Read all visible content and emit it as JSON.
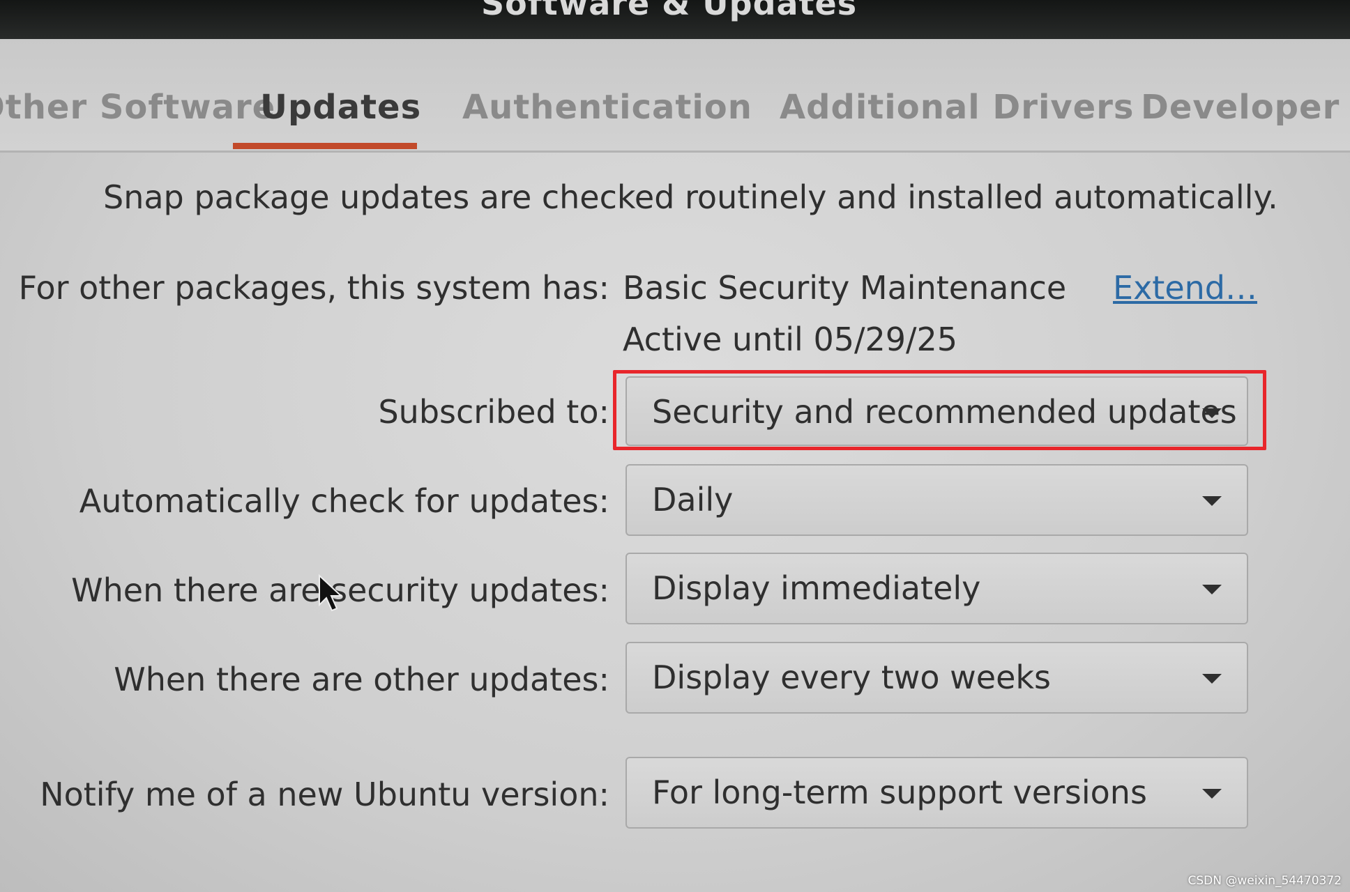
{
  "window": {
    "title": "Software & Updates"
  },
  "tabs": [
    {
      "label": "Other Software"
    },
    {
      "label": "Updates"
    },
    {
      "label": "Authentication"
    },
    {
      "label": "Additional Drivers"
    },
    {
      "label": "Developer Options"
    }
  ],
  "active_tab": "Updates",
  "snap_notice": "Snap package updates are checked routinely and installed automatically.",
  "support": {
    "label": "For other packages, this system has:",
    "plan": "Basic Security Maintenance",
    "active_until": "Active until 05/29/25",
    "extend_link": "Extend…"
  },
  "settings": {
    "subscribed": {
      "label": "Subscribed to:",
      "value": "Security and recommended updates"
    },
    "auto_check": {
      "label": "Automatically check for updates:",
      "value": "Daily"
    },
    "security_updates": {
      "label": "When there are security updates:",
      "value": "Display immediately"
    },
    "other_updates": {
      "label": "When there are other updates:",
      "value": "Display every two weeks"
    },
    "new_version": {
      "label": "Notify me of a new Ubuntu version:",
      "value": "For long-term support versions"
    }
  },
  "annotation": {
    "color": "#e8262b"
  },
  "watermark": "CSDN @weixin_54470372",
  "icons": {
    "dropdown": "chevron-down-icon",
    "pointer": "mouse-pointer-icon"
  }
}
